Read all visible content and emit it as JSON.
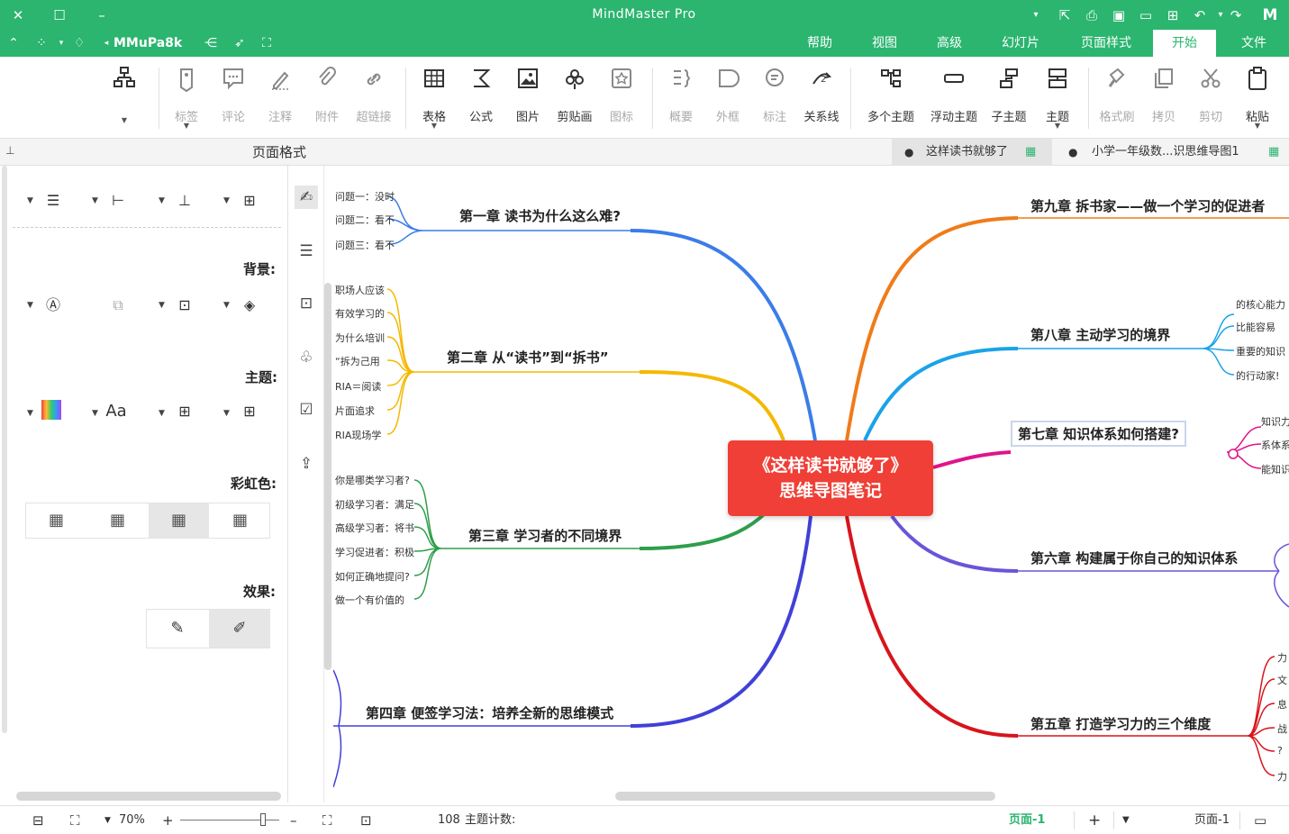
{
  "window": {
    "title": "MindMaster Pro",
    "brand_color": "#2bb56f"
  },
  "quick_access": {
    "user_label": "MMuPa8k",
    "icons": [
      "theme-icon",
      "apps-icon",
      "expand-icon",
      "share-icon",
      "cursor-icon",
      "fullscreen-icon"
    ]
  },
  "ribbon_tabs": [
    {
      "label": "文件"
    },
    {
      "label": "开始",
      "active": true
    },
    {
      "label": "页面样式"
    },
    {
      "label": "幻灯片"
    },
    {
      "label": "高级"
    },
    {
      "label": "视图"
    },
    {
      "label": "帮助"
    }
  ],
  "toolbar": {
    "paste": "粘贴",
    "cut": "剪切",
    "copy": "拷贝",
    "format_painter": "格式刷",
    "topic": "主题",
    "subtopic": "子主题",
    "floating_topic": "浮动主题",
    "multi_topic": "多个主题",
    "relation": "关系线",
    "callout": "标注",
    "boundary": "外框",
    "summary": "概要",
    "icon": "图标",
    "clipart": "剪贴画",
    "picture": "图片",
    "formula": "公式",
    "table": "表格",
    "hyperlink": "超链接",
    "attachment": "附件",
    "note": "注释",
    "comment": "评论",
    "tag": "标签"
  },
  "document_tabs": [
    {
      "label": "小学一年级数...识思维导图1"
    },
    {
      "label": "这样读书就够了",
      "active": true
    }
  ],
  "side_panel": {
    "title": "页面格式",
    "background_heading": "背景:",
    "theme_heading": "主题:",
    "rainbow_heading": "彩虹色:",
    "effect_heading": "效果:"
  },
  "mindmap": {
    "central": [
      "《这样读书就够了》",
      "思维导图笔记"
    ],
    "left_topics": [
      {
        "title": "第一章 读书为什么这么难?",
        "color": "#3b7de8",
        "subs": [
          "问题一：没时",
          "问题二：看不",
          "问题三：看不"
        ]
      },
      {
        "title": "第二章 从“读书”到“拆书”",
        "color": "#f5b800",
        "subs": [
          "职场人应该",
          "有效学习的",
          "为什么培训",
          "“拆为己用",
          "RIA＝阅读",
          "片面追求",
          "RIA现场学"
        ]
      },
      {
        "title": "第三章 学习者的不同境界",
        "color": "#2e9e4b",
        "subs": [
          "你是哪类学习者?",
          "初级学习者：满足",
          "高级学习者：将书",
          "学习促进者：积极",
          "如何正确地提问?",
          "做一个有价值的"
        ]
      },
      {
        "title": "第四章 便签学习法：培养全新的思维模式",
        "color": "#4040d8",
        "subs": []
      }
    ],
    "right_topics": [
      {
        "title": "第九章 拆书家——做一个学习的促进者",
        "color": "#f07b1a",
        "subs": []
      },
      {
        "title": "第八章 主动学习的境界",
        "color": "#1aa3e8",
        "subs": [
          "的核心能力",
          "比能容易",
          "重要的知识",
          "的行动家!"
        ]
      },
      {
        "title": "第七章 知识体系如何搭建?",
        "color": "#e0138c",
        "subs": [
          "知识力",
          "系体系",
          "能知识"
        ]
      },
      {
        "title": "第六章 构建属于你自己的知识体系",
        "color": "#6a55d8",
        "subs": []
      },
      {
        "title": "第五章 打造学习力的三个维度",
        "color": "#d8141c",
        "subs": [
          "力",
          "文",
          "息",
          "战",
          "?",
          "力"
        ]
      }
    ]
  },
  "statusbar": {
    "page_tab": "页面-1",
    "active_page_tab": "页面-1",
    "topic_count_label": "主题计数:",
    "topic_count": "108",
    "zoom": "70%"
  }
}
